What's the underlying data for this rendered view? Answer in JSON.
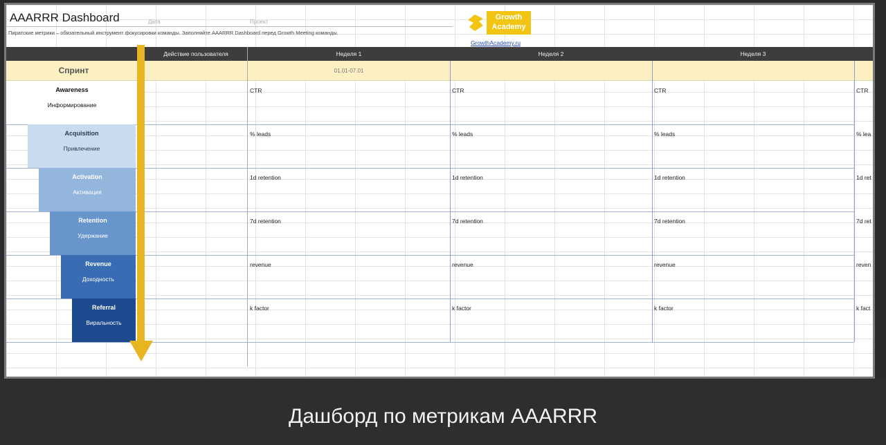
{
  "sheet": {
    "title": "AAARRR Dashboard",
    "date_label": "Дата",
    "project_label": "Проект",
    "description": "Пиратские метрики – обязательный инструмент фокусировки команды. Заполняйте AAARRR Dashboard перед Growth Meeting команды.",
    "logo_text": "Growth Academy",
    "logo_link": "GrowthAcademy.ru"
  },
  "header": {
    "user_action": "Действие пользователя",
    "week1": "Неделя 1",
    "week2": "Неделя 2",
    "week3": "Неделя 3"
  },
  "sprint": {
    "label": "Спринт",
    "dates": "01.01-07.01"
  },
  "stages": [
    {
      "en": "Awareness",
      "ru": "Информирование",
      "metric": "CTR",
      "metric_cut": "CTR",
      "color": "#ffffff",
      "text": "#111111"
    },
    {
      "en": "Acquisition",
      "ru": "Привлечение",
      "metric": "% leads",
      "metric_cut": "% lea",
      "color": "#c9dcef",
      "text": "#2a3a55"
    },
    {
      "en": "Activation",
      "ru": "Активация",
      "metric": "1d retention",
      "metric_cut": "1d ret",
      "color": "#95b6dc",
      "text": "#ffffff"
    },
    {
      "en": "Retention",
      "ru": "Удержание",
      "metric": "7d retention",
      "metric_cut": "7d ret",
      "color": "#6895cc",
      "text": "#ffffff"
    },
    {
      "en": "Revenue",
      "ru": "Доходность",
      "metric": "revenue",
      "metric_cut": "reven",
      "color": "#3a6cb3",
      "text": "#ffffff"
    },
    {
      "en": "Referral",
      "ru": "Виральность",
      "metric": "k factor",
      "metric_cut": "k fact",
      "color": "#1e4a8f",
      "text": "#ffffff"
    }
  ],
  "caption": "Дашборд по метрикам AAARRR"
}
